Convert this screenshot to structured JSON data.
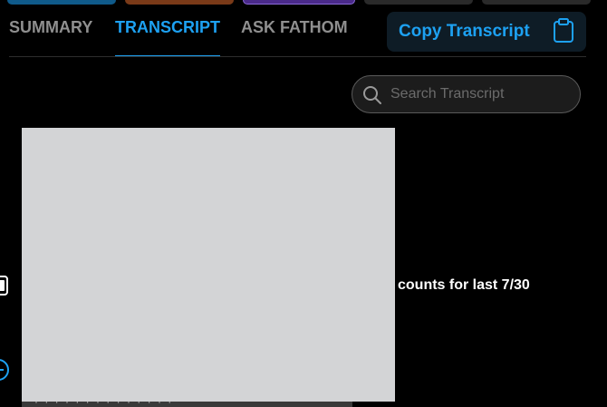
{
  "tabs": [
    {
      "label": "SUMMARY",
      "active": false
    },
    {
      "label": "TRANSCRIPT",
      "active": true
    },
    {
      "label": "ASK FATHOM",
      "active": false
    }
  ],
  "copy_button": {
    "label": "Copy Transcript",
    "icon": "clipboard-icon"
  },
  "search": {
    "placeholder": "Search Transcript",
    "value": "",
    "icon": "search-icon"
  },
  "transcript": {
    "visible_text": "counts for last 7/30",
    "partial_line": "· · · · · · · · · · · · · ·"
  },
  "colors": {
    "accent": "#1da1f2",
    "background": "#000000",
    "redaction": "#d3d4d6",
    "tab_inactive": "#8f8f8f"
  }
}
